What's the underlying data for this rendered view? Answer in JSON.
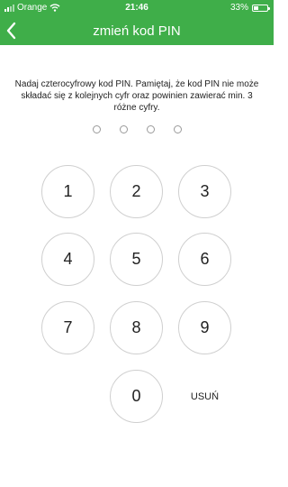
{
  "status_bar": {
    "carrier": "Orange",
    "time": "21:46",
    "battery": "33%",
    "battery_level": 0.33
  },
  "header": {
    "title": "zmień kod PIN",
    "back_icon": "chevron-left-icon"
  },
  "instruction": "Nadaj czterocyfrowy kod PIN. Pamiętaj, że kod PIN nie może składać się z kolejnych cyfr oraz powinien zawierać min. 3 różne cyfry.",
  "pin": {
    "length": 4,
    "entered": 0
  },
  "keypad": {
    "k1": "1",
    "k2": "2",
    "k3": "3",
    "k4": "4",
    "k5": "5",
    "k6": "6",
    "k7": "7",
    "k8": "8",
    "k9": "9",
    "k0": "0",
    "delete": "USUŃ"
  },
  "colors": {
    "accent": "#3fae49",
    "key_border": "#cfcfcf"
  }
}
